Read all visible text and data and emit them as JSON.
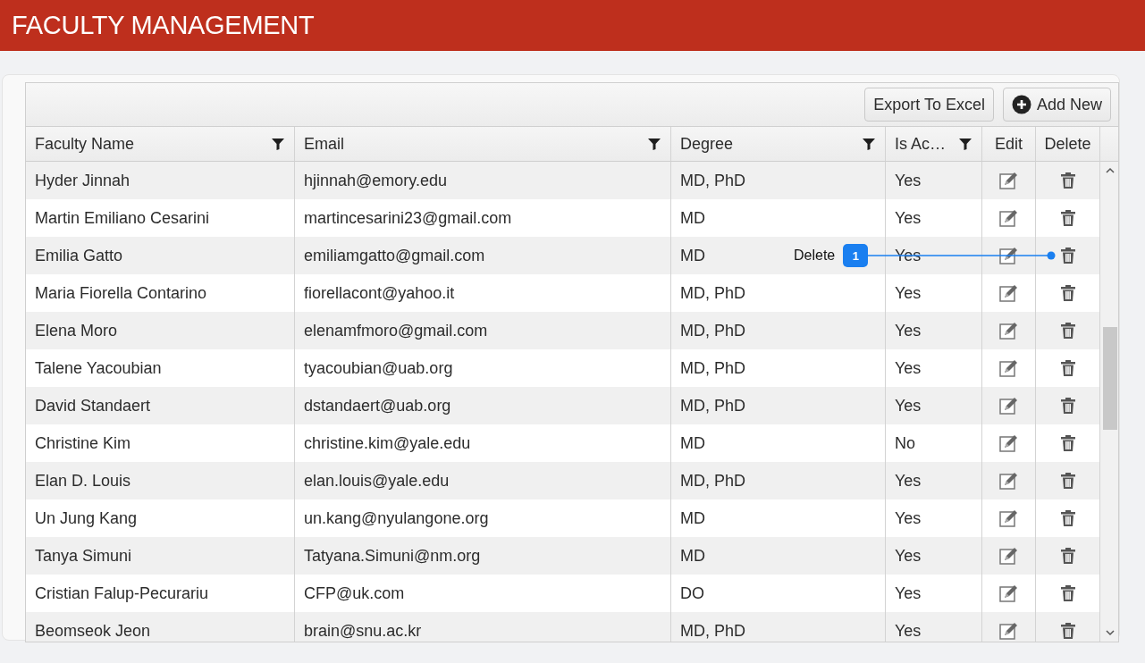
{
  "header": {
    "title": "FACULTY MANAGEMENT"
  },
  "toolbar": {
    "buttons": [
      {
        "label": "Export To Excel",
        "kind": "plain"
      },
      {
        "label": "Add New",
        "kind": "add"
      }
    ]
  },
  "table": {
    "columns": [
      {
        "label": "Faculty Name",
        "filter": true
      },
      {
        "label": "Email",
        "filter": true
      },
      {
        "label": "Degree",
        "filter": true
      },
      {
        "label": "Is Ac…",
        "filter": true
      },
      {
        "label": "Edit",
        "filter": false
      },
      {
        "label": "Delete",
        "filter": false
      }
    ],
    "rows": [
      {
        "name": "Hyder Jinnah",
        "email": "hjinnah@emory.edu",
        "degree": "MD, PhD",
        "active": "Yes"
      },
      {
        "name": "Martin Emiliano Cesarini",
        "email": "martincesarini23@gmail.com",
        "degree": "MD",
        "active": "Yes"
      },
      {
        "name": "Emilia Gatto",
        "email": "emiliamgatto@gmail.com",
        "degree": "MD",
        "active": "Yes",
        "callout": {
          "label": "Delete",
          "badge": "1"
        }
      },
      {
        "name": "Maria Fiorella Contarino",
        "email": "fiorellacont@yahoo.it",
        "degree": "MD, PhD",
        "active": "Yes"
      },
      {
        "name": "Elena Moro",
        "email": "elenamfmoro@gmail.com",
        "degree": "MD, PhD",
        "active": "Yes"
      },
      {
        "name": "Talene Yacoubian",
        "email": "tyacoubian@uab.org",
        "degree": "MD, PhD",
        "active": "Yes"
      },
      {
        "name": "David Standaert",
        "email": "dstandaert@uab.org",
        "degree": "MD, PhD",
        "active": "Yes"
      },
      {
        "name": "Christine Kim",
        "email": "christine.kim@yale.edu",
        "degree": "MD",
        "active": "No"
      },
      {
        "name": "Elan D. Louis",
        "email": "elan.louis@yale.edu",
        "degree": "MD, PhD",
        "active": "Yes"
      },
      {
        "name": "Un Jung Kang",
        "email": "un.kang@nyulangone.org",
        "degree": "MD",
        "active": "Yes"
      },
      {
        "name": "Tanya Simuni",
        "email": "Tatyana.Simuni@nm.org",
        "degree": "MD",
        "active": "Yes"
      },
      {
        "name": "Cristian Falup-Pecurariu",
        "email": "CFP@uk.com",
        "degree": "DO",
        "active": "Yes"
      },
      {
        "name": "Beomseok Jeon",
        "email": "brain@snu.ac.kr",
        "degree": "MD, PhD",
        "active": "Yes"
      }
    ]
  }
}
